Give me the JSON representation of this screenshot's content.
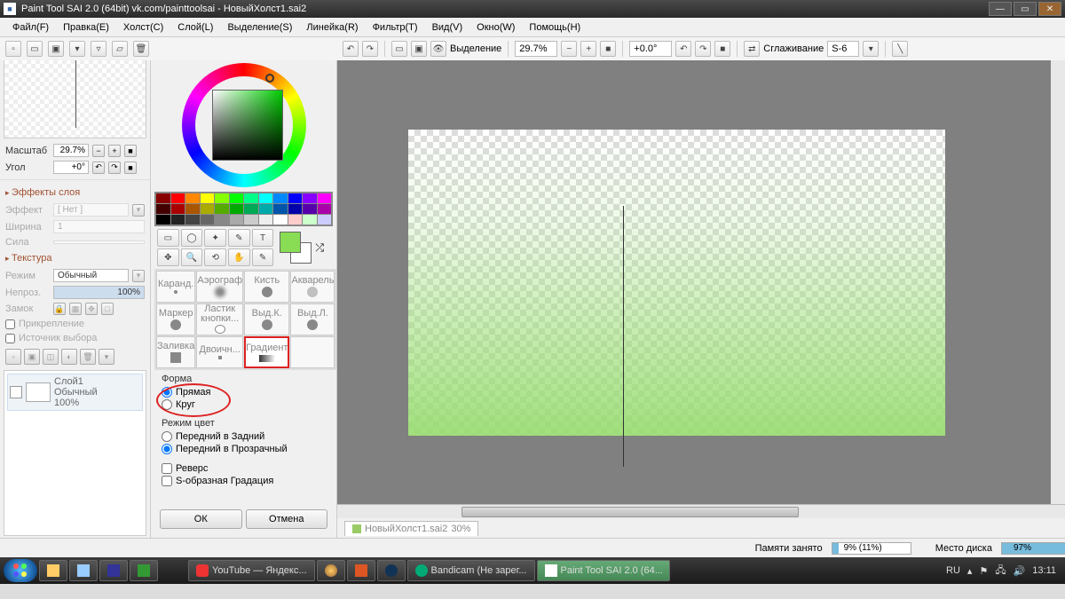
{
  "title": "Paint Tool SAI 2.0 (64bit) vk.com/painttoolsai - НовыйХолст1.sai2",
  "menu": {
    "file": "Файл(F)",
    "edit": "Правка(E)",
    "canvas": "Холст(C)",
    "layer": "Слой(L)",
    "selection": "Выделение(S)",
    "ruler": "Линейка(R)",
    "filter": "Фильтр(T)",
    "view": "Вид(V)",
    "window": "Окно(W)",
    "help": "Помощь(H)"
  },
  "toolbar": {
    "selection_label": "Выделение",
    "zoom": "29.7%",
    "rotation": "+0.0°",
    "smoothing_label": "Сглаживание",
    "smoothing_value": "S-6"
  },
  "nav": {
    "scale_label": "Масштаб",
    "scale_value": "29.7%",
    "angle_label": "Угол",
    "angle_value": "+0°"
  },
  "effects": {
    "title": "Эффекты слоя",
    "effect_label": "Эффект",
    "effect_value": "[ Нет ]",
    "width_label": "Ширина",
    "width_value": "1",
    "strength_label": "Сила",
    "strength_value": ""
  },
  "texture": {
    "title": "Текстура",
    "mode_label": "Режим",
    "mode_value": "Обычный",
    "opacity_label": "Непроз.",
    "opacity_value": "100%",
    "lock_label": "Замок",
    "pin_label": "Прикрепление",
    "source_label": "Источник выбора"
  },
  "layer": {
    "name": "Слой1",
    "mode": "Обычный",
    "opacity": "100%"
  },
  "brushes": {
    "b1": "Каранд.",
    "b2": "Аэрограф",
    "b3": "Кисть",
    "b4": "Акварель",
    "b5": "Маркер",
    "b6": "Ластик кнопки...",
    "b7": "Выд.К.",
    "b8": "Выд.Л.",
    "b9": "Заливка",
    "b10": "Двоичн...",
    "b11": "Градиент"
  },
  "gradient": {
    "shape_title": "Форма",
    "shape_line": "Прямая",
    "shape_circle": "Круг",
    "colormode_title": "Режим цвет",
    "fg_bg": "Передний в Задний",
    "fg_trans": "Передний в Прозрачный",
    "reverse": "Реверс",
    "s_curve": "S-образная Градация",
    "ok": "ОК",
    "cancel": "Отмена"
  },
  "doctab": {
    "name": "НовыйХолст1.sai2",
    "pct": "30%"
  },
  "status": {
    "mem_label": "Памяти занято",
    "mem_value": "9% (11%)",
    "disk_label": "Место диска",
    "disk_value": "97%"
  },
  "taskbar": {
    "youtube": "YouTube — Яндекс...",
    "bandicam": "Bandicam (Не зарег...",
    "sai": "Paint Tool SAI 2.0 (64...",
    "lang": "RU",
    "time": "13:11"
  }
}
